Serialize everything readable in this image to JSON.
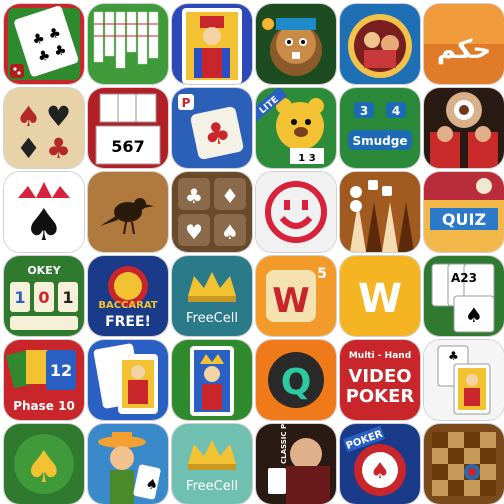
{
  "grid_label": "Card and board game app icons",
  "icons": [
    {
      "name": "solitaire-clubs-icon"
    },
    {
      "name": "spider-solitaire-icon"
    },
    {
      "name": "king-card-icon"
    },
    {
      "name": "beaver-game-icon"
    },
    {
      "name": "circus-game-icon"
    },
    {
      "name": "hakam-card-game-icon",
      "text": "حكم"
    },
    {
      "name": "card-suits-icon"
    },
    {
      "name": "solitaire-cards-icon",
      "text": "567"
    },
    {
      "name": "mahjong-joker-icon",
      "text": "P"
    },
    {
      "name": "bear-lite-icon",
      "text": "LITE",
      "numbers": "1 3"
    },
    {
      "name": "smudge-game-icon",
      "n1": "3",
      "n2": "4",
      "text": "Smudge"
    },
    {
      "name": "elvis-game-icon"
    },
    {
      "name": "crown-spade-icon"
    },
    {
      "name": "raven-icon"
    },
    {
      "name": "four-suits-icon"
    },
    {
      "name": "smiley-face-icon"
    },
    {
      "name": "backgammon-icon"
    },
    {
      "name": "quiz-icon",
      "text": "QUIZ"
    },
    {
      "name": "okey-icon",
      "title": "OKEY",
      "tiles": [
        "1",
        "0",
        "1"
      ]
    },
    {
      "name": "baccarat-free-icon",
      "t1": "BACCARAT",
      "t2": "FREE!"
    },
    {
      "name": "freecell-crown-icon",
      "text": "FreeCell"
    },
    {
      "name": "word-w-tile-icon",
      "letter": "W",
      "num": "5"
    },
    {
      "name": "word-w-yellow-icon",
      "letter": "W"
    },
    {
      "name": "solitaire-3-icon",
      "text": "A23"
    },
    {
      "name": "phase-10-icon",
      "num": "12",
      "text": "Phase 10"
    },
    {
      "name": "jack-card-icon"
    },
    {
      "name": "king-solitaire-icon"
    },
    {
      "name": "q-game-icon",
      "letter": "Q"
    },
    {
      "name": "video-poker-icon",
      "t1": "Multi - Hand",
      "t2": "VIDEO",
      "t3": "POKER"
    },
    {
      "name": "jack-solitaire-icon"
    },
    {
      "name": "spade-gold-icon"
    },
    {
      "name": "cowboy-cards-icon"
    },
    {
      "name": "freecell-crown-icon-2",
      "text": "FreeCell"
    },
    {
      "name": "classic-poker-icon",
      "text": "CLASSIC POKER"
    },
    {
      "name": "poker-chip-icon",
      "text": "POKER"
    },
    {
      "name": "checkers-board-icon"
    }
  ]
}
